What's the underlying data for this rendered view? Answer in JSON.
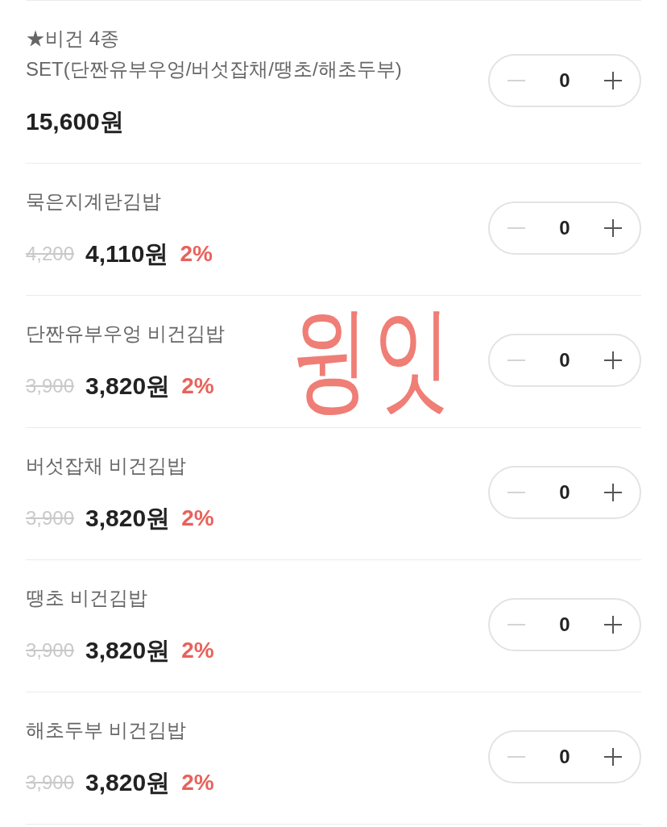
{
  "items": [
    {
      "name": "★비건 4종\nSET(단짠유부우엉/버섯잡채/땡초/해초두부)",
      "price": "15,600원",
      "quantity": "0",
      "decrease_disabled": true
    },
    {
      "name": "묵은지계란김밥",
      "original_price": "4,200",
      "price": "4,110원",
      "discount": "2%",
      "quantity": "0",
      "decrease_disabled": true
    },
    {
      "name": "단짠유부우엉 비건김밥",
      "original_price": "3,900",
      "price": "3,820원",
      "discount": "2%",
      "quantity": "0",
      "decrease_disabled": true
    },
    {
      "name": "버섯잡채 비건김밥",
      "original_price": "3,900",
      "price": "3,820원",
      "discount": "2%",
      "quantity": "0",
      "decrease_disabled": true
    },
    {
      "name": "땡초 비건김밥",
      "original_price": "3,900",
      "price": "3,820원",
      "discount": "2%",
      "quantity": "0",
      "decrease_disabled": true
    },
    {
      "name": "해초두부 비건김밥",
      "original_price": "3,900",
      "price": "3,820원",
      "discount": "2%",
      "quantity": "0",
      "decrease_disabled": true
    }
  ],
  "annotation": {
    "text": "윙잇"
  }
}
